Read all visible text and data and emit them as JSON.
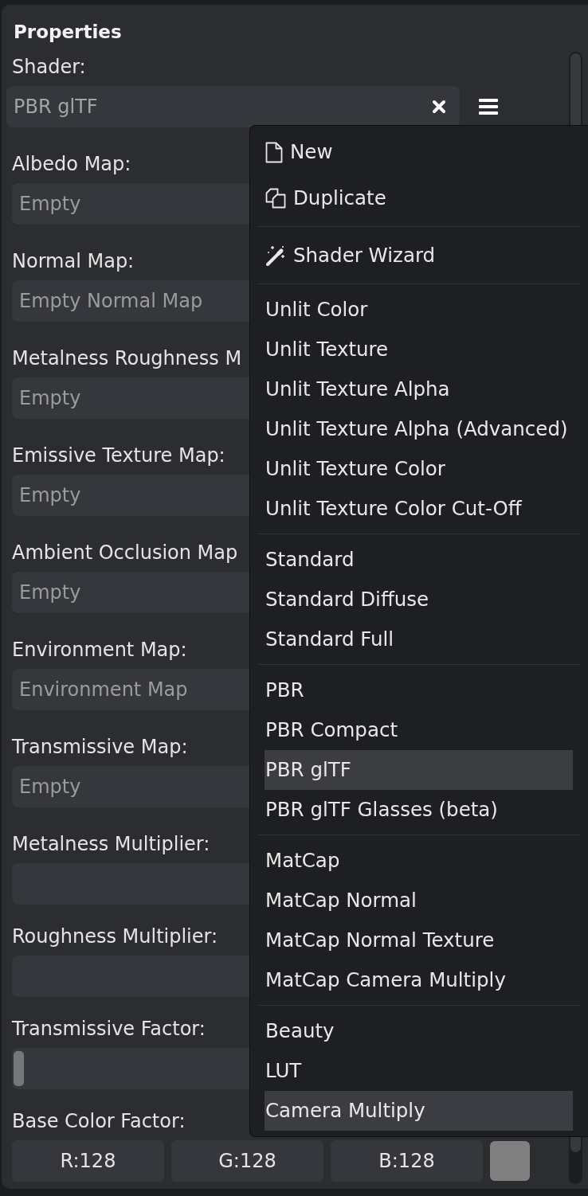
{
  "panel": {
    "title": "Properties"
  },
  "shader": {
    "label": "Shader:",
    "value": "PBR glTF"
  },
  "fields": [
    {
      "kind": "map",
      "label": "Albedo Map:",
      "placeholder": "Empty"
    },
    {
      "kind": "map",
      "label": "Normal Map:",
      "placeholder": "Empty Normal Map"
    },
    {
      "kind": "map",
      "label": "Metalness Roughness M",
      "placeholder": "Empty"
    },
    {
      "kind": "map",
      "label": "Emissive Texture Map:",
      "placeholder": "Empty"
    },
    {
      "kind": "map",
      "label": "Ambient Occlusion Map",
      "placeholder": "Empty"
    },
    {
      "kind": "map",
      "label": "Environment Map:",
      "placeholder": "Environment Map"
    },
    {
      "kind": "map",
      "label": "Transmissive Map:",
      "placeholder": "Empty"
    },
    {
      "kind": "slider",
      "label": "Metalness Multiplier:"
    },
    {
      "kind": "slider",
      "label": "Roughness Multiplier:"
    },
    {
      "kind": "slider",
      "label": "Transmissive Factor:",
      "level": 0
    }
  ],
  "base_color": {
    "label": "Base Color Factor:",
    "channels": [
      "R:128",
      "G:128",
      "B:128"
    ],
    "swatch": {
      "color": "#808080"
    }
  },
  "menu": {
    "groups": [
      [
        {
          "kind": "new",
          "label": "New",
          "selected": false,
          "hovered": false
        },
        {
          "kind": "duplicate",
          "label": "Duplicate",
          "selected": false,
          "hovered": false
        }
      ],
      [
        {
          "kind": "wizard",
          "label": "Shader Wizard",
          "selected": false,
          "hovered": false
        }
      ],
      [
        {
          "kind": "shader",
          "label": "Unlit Color",
          "selected": false,
          "hovered": false
        },
        {
          "kind": "shader",
          "label": "Unlit Texture",
          "selected": false,
          "hovered": false
        },
        {
          "kind": "shader",
          "label": "Unlit Texture Alpha",
          "selected": false,
          "hovered": false
        },
        {
          "kind": "shader",
          "label": "Unlit Texture Alpha (Advanced)",
          "selected": false,
          "hovered": false
        },
        {
          "kind": "shader",
          "label": "Unlit Texture Color",
          "selected": false,
          "hovered": false
        },
        {
          "kind": "shader",
          "label": "Unlit Texture Color Cut-Off",
          "selected": false,
          "hovered": false
        }
      ],
      [
        {
          "kind": "shader",
          "label": "Standard",
          "selected": false,
          "hovered": false
        },
        {
          "kind": "shader",
          "label": "Standard Diffuse",
          "selected": false,
          "hovered": false
        },
        {
          "kind": "shader",
          "label": "Standard Full",
          "selected": false,
          "hovered": false
        }
      ],
      [
        {
          "kind": "shader",
          "label": "PBR",
          "selected": false,
          "hovered": false
        },
        {
          "kind": "shader",
          "label": "PBR Compact",
          "selected": false,
          "hovered": false
        },
        {
          "kind": "shader",
          "label": "PBR glTF",
          "selected": true,
          "hovered": false
        },
        {
          "kind": "shader",
          "label": "PBR glTF Glasses (beta)",
          "selected": false,
          "hovered": false
        }
      ],
      [
        {
          "kind": "shader",
          "label": "MatCap",
          "selected": false,
          "hovered": false
        },
        {
          "kind": "shader",
          "label": "MatCap Normal",
          "selected": false,
          "hovered": false
        },
        {
          "kind": "shader",
          "label": "MatCap Normal Texture",
          "selected": false,
          "hovered": false
        },
        {
          "kind": "shader",
          "label": "MatCap Camera Multiply",
          "selected": false,
          "hovered": false
        }
      ],
      [
        {
          "kind": "shader",
          "label": "Beauty",
          "selected": false,
          "hovered": false
        },
        {
          "kind": "shader",
          "label": "LUT",
          "selected": false,
          "hovered": false
        },
        {
          "kind": "shader",
          "label": "Camera Multiply",
          "selected": false,
          "hovered": true
        }
      ]
    ]
  }
}
